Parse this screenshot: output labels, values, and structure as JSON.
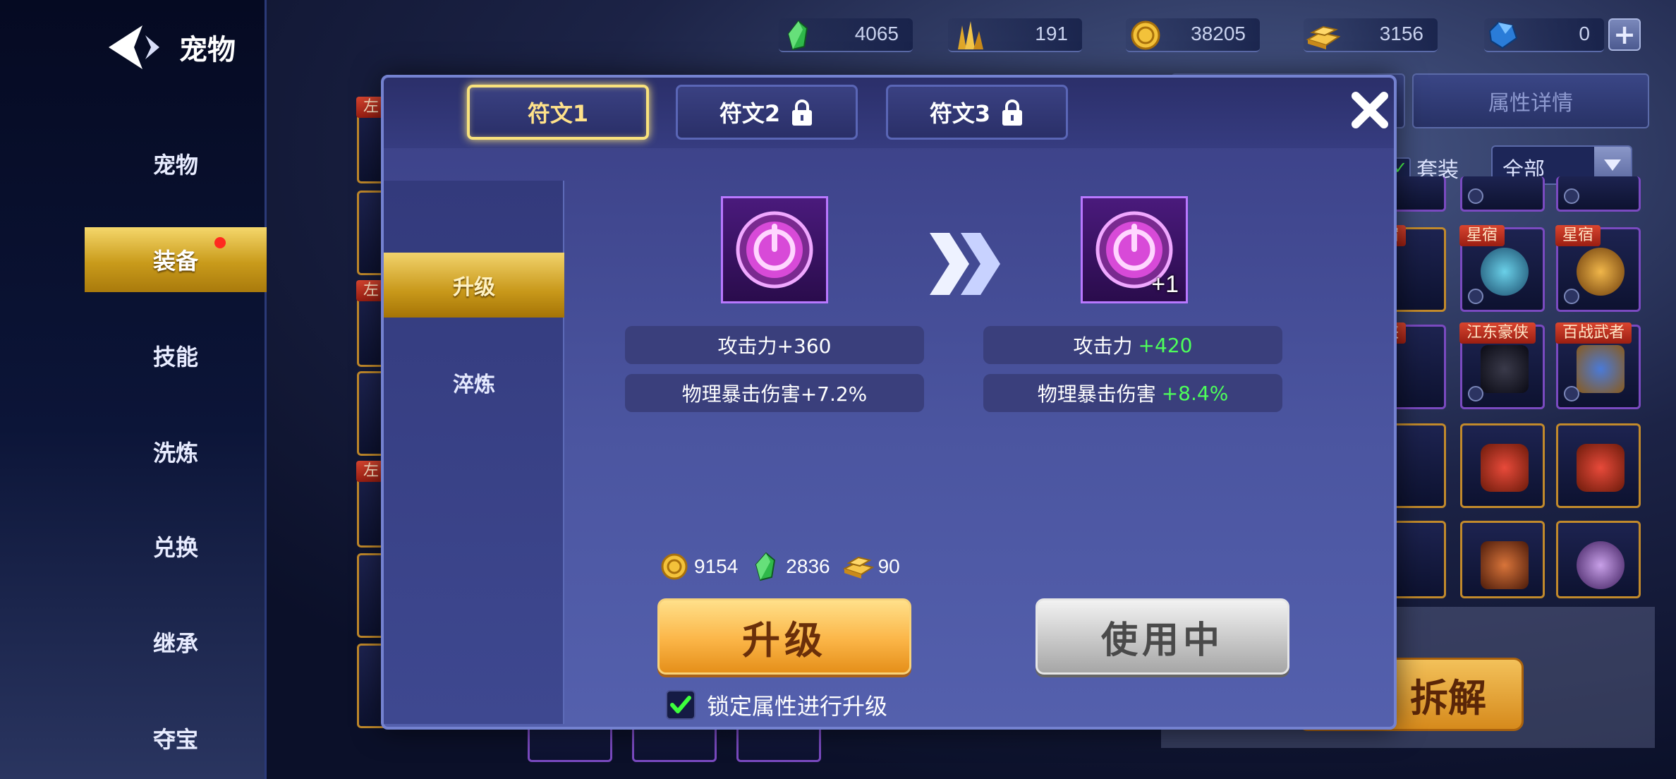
{
  "header": {
    "back_title": "宠物"
  },
  "nav": {
    "items": [
      {
        "label": "宠物",
        "active": false
      },
      {
        "label": "装备",
        "active": true,
        "has_dot": true
      },
      {
        "label": "技能",
        "active": false
      },
      {
        "label": "洗炼",
        "active": false
      },
      {
        "label": "兑换",
        "active": false
      },
      {
        "label": "继承",
        "active": false
      },
      {
        "label": "夺宝",
        "active": false
      }
    ]
  },
  "currencies": [
    {
      "icon": "green-gem-icon",
      "value": "4065"
    },
    {
      "icon": "gold-crystal-icon",
      "value": "191"
    },
    {
      "icon": "gold-coin-icon",
      "value": "38205"
    },
    {
      "icon": "gold-bar-icon",
      "value": "3156"
    },
    {
      "icon": "blue-diamond-icon",
      "value": "0"
    }
  ],
  "background_panel": {
    "tab_attr_label": "属性详情",
    "set_label": "套装",
    "filter_value": "全部",
    "slot_tags": [
      "星宿",
      "星宿",
      "星宿",
      "豪侠",
      "江东豪侠",
      "百战武者"
    ],
    "left_tags": [
      "左",
      "左",
      "左"
    ],
    "decompose_label": "拆解"
  },
  "modal": {
    "tabs": [
      {
        "label": "符文1",
        "active": true,
        "locked": false
      },
      {
        "label": "符文2",
        "active": false,
        "locked": true
      },
      {
        "label": "符文3",
        "active": false,
        "locked": true
      }
    ],
    "side_tabs": [
      {
        "label": "升级",
        "active": true
      },
      {
        "label": "淬炼",
        "active": false
      }
    ],
    "current": {
      "stats": [
        {
          "label": "攻击力+360",
          "plus": ""
        },
        {
          "label": "物理暴击伤害+7.2%",
          "plus": ""
        }
      ]
    },
    "next": {
      "level_badge": "+1",
      "stats": [
        {
          "label": "攻击力",
          "plus": "+420"
        },
        {
          "label": "物理暴击伤害",
          "plus": "+8.4%"
        }
      ]
    },
    "costs": [
      {
        "icon": "gold-coin-icon",
        "value": "9154"
      },
      {
        "icon": "green-gem-icon",
        "value": "2836"
      },
      {
        "icon": "gold-bar-icon",
        "value": "90"
      }
    ],
    "upgrade_label": "升级",
    "in_use_label": "使用中",
    "lock_label": "锁定属性进行升级",
    "lock_checked": true
  },
  "colors": {
    "accent_gold": "#f9e27c",
    "stat_increase": "#4dff5a",
    "rune_border": "#b978ff"
  }
}
